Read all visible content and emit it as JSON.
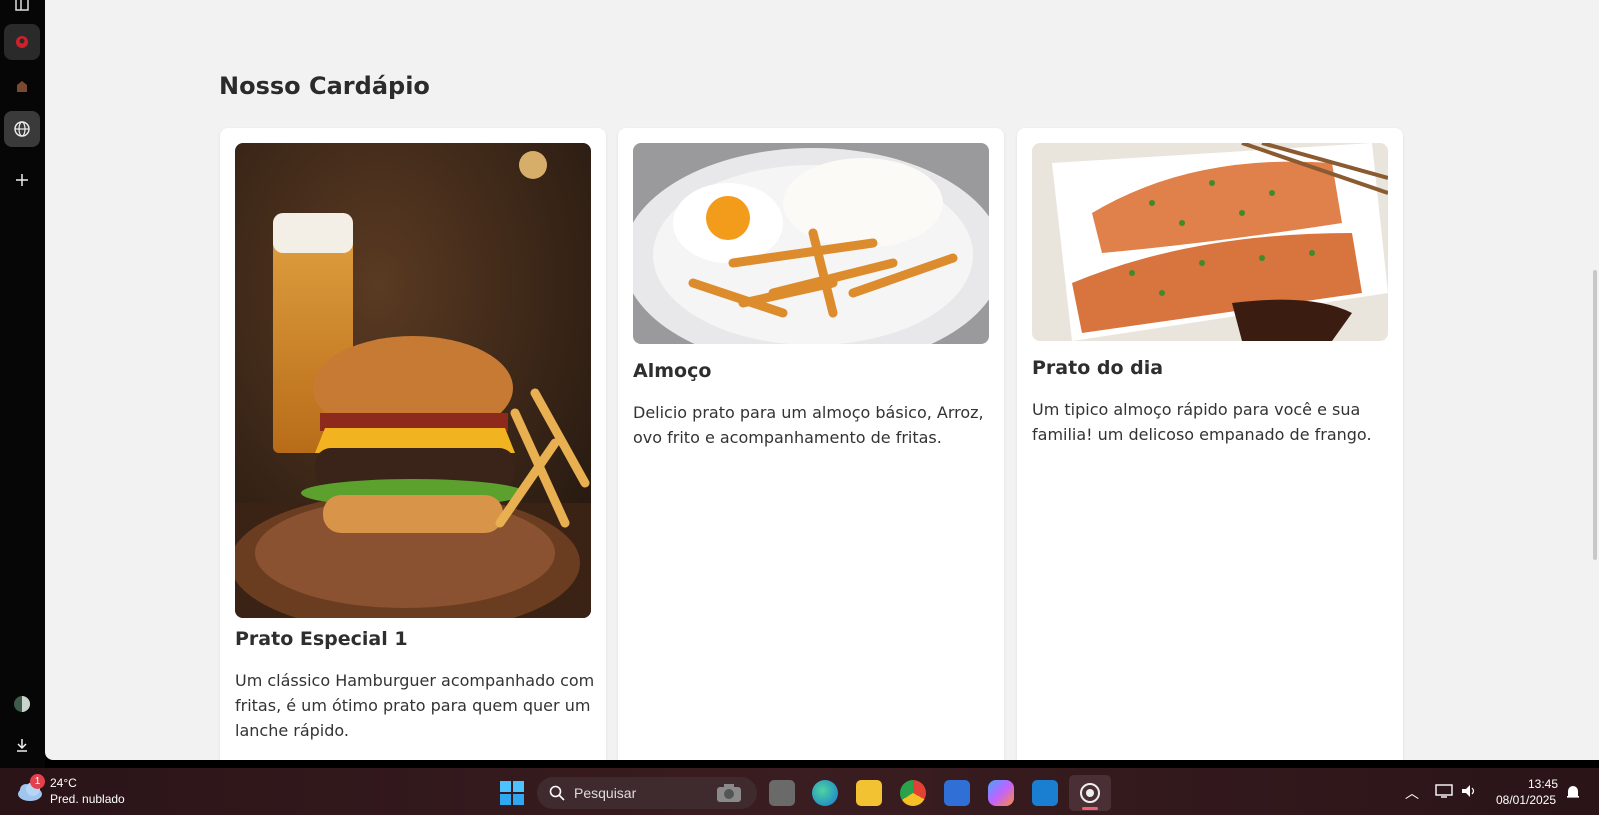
{
  "page": {
    "heading": "Nosso Cardápio",
    "cards": [
      {
        "title": "Prato Especial 1",
        "description": "Um clássico Hamburguer acompanhado com fritas, é um ótimo prato para quem quer um lanche rápido."
      },
      {
        "title": "Almoço",
        "description": "Delicio prato para um almoço básico, Arroz, ovo frito e acompanhamento de fritas."
      },
      {
        "title": "Prato do dia",
        "description": "Um tipico almoço rápido para você e sua familia! um delicoso empanado de frango."
      }
    ]
  },
  "taskbar": {
    "weather": {
      "badge": "1",
      "temp": "24°C",
      "condition": "Pred. nublado"
    },
    "search_placeholder": "Pesquisar",
    "clock": {
      "time": "13:45",
      "date": "08/01/2025"
    }
  },
  "colors": {
    "page_bg": "#f2f2f2",
    "card_bg": "#ffffff",
    "taskbar_bg": "#2f181b",
    "sidebar_bg": "#060606"
  }
}
